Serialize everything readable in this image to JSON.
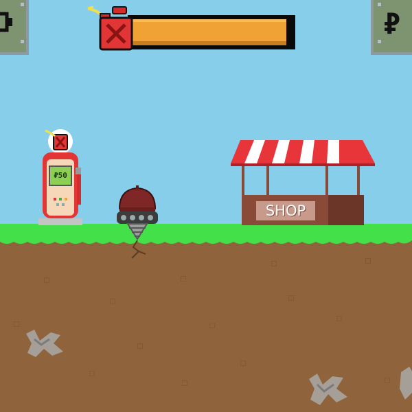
{
  "hud": {
    "fuel_level_percent": 96,
    "left_panel_icon": "gear-icon",
    "right_panel_icon": "ruble-icon",
    "right_panel_symbol": "₽",
    "fuel_icon": "fuel-can-icon"
  },
  "pump": {
    "price_label": "₽50",
    "icon": "fuel-can-icon"
  },
  "shop": {
    "sign_label": "SHOP"
  },
  "colors": {
    "sky": "#87ceeb",
    "grass": "#43e04a",
    "dirt": "#8f633b",
    "fuel_fill": "#f0a235",
    "panel": "#7e9470",
    "awning_red": "#e8353a",
    "shop_wood": "#8a4a38"
  }
}
